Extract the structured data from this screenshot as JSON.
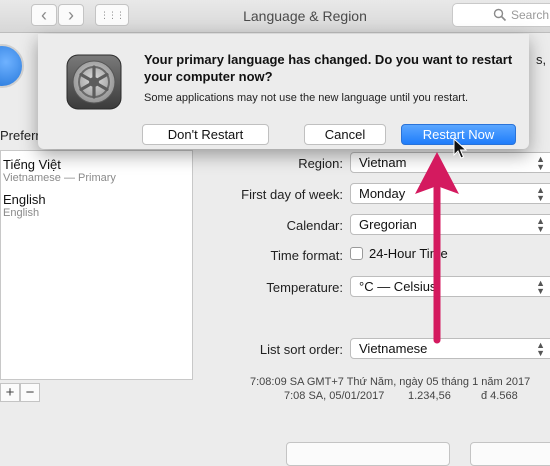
{
  "toolbar": {
    "title": "Language & Region",
    "search_placeholder": "Search",
    "back_glyph": "‹",
    "forward_glyph": "›",
    "grid_glyph": "⋮⋮⋮"
  },
  "window": {
    "right_edge_text": "s,",
    "preferred_label": "Preferre",
    "languages": [
      {
        "name": "Tiếng Việt",
        "sub": "Vietnamese — Primary"
      },
      {
        "name": "English",
        "sub": "English"
      }
    ],
    "add_glyph": "+",
    "remove_glyph": "−",
    "form": {
      "region_label": "Region:",
      "region_value": "Vietnam",
      "first_day_label": "First day of week:",
      "first_day_value": "Monday",
      "calendar_label": "Calendar:",
      "calendar_value": "Gregorian",
      "time_format_label": "Time format:",
      "time_format_checkbox": "24-Hour Time",
      "temperature_label": "Temperature:",
      "temperature_value": "°C — Celsius",
      "sort_order_label": "List sort order:",
      "sort_order_value": "Vietnamese"
    },
    "sample_line1": "7:08:09 SA GMT+7 Thứ Năm, ngày 05 tháng 1 năm 2017",
    "sample_line2_a": "7:08 SA, 05/01/2017",
    "sample_line2_b": "1.234,56",
    "sample_line2_c": "đ 4.568"
  },
  "dialog": {
    "title": "Your primary language has changed. Do you want to restart your computer now?",
    "body": "Some applications may not use the new language until you restart.",
    "dont_restart": "Don't Restart",
    "cancel": "Cancel",
    "restart_now": "Restart Now"
  },
  "colors": {
    "primary_button": "#1f7dfb",
    "annotation_arrow": "#d41a5f"
  },
  "icons": {
    "app_icon": "system-preferences-gear-icon",
    "globe": "globe-flag-icon",
    "search": "search-icon",
    "arrow": "annotation-arrow-icon",
    "cursor": "mouse-pointer-icon"
  }
}
